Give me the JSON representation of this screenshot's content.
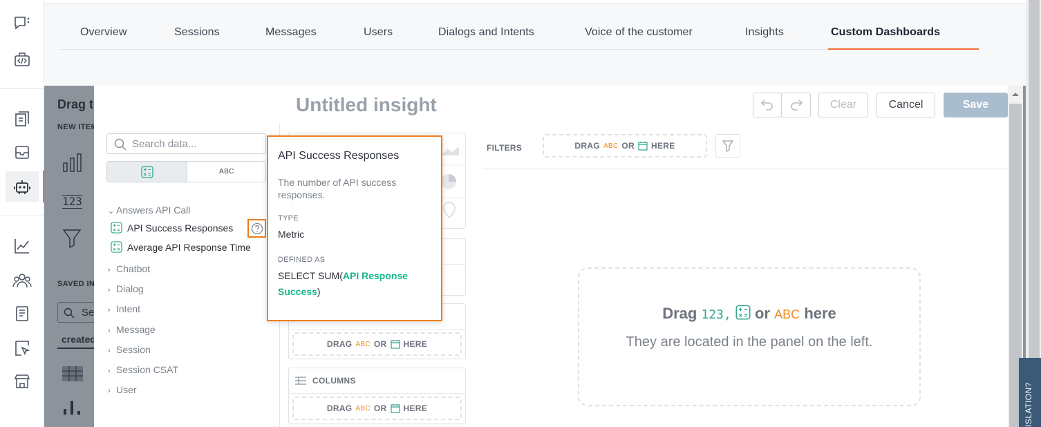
{
  "nav": {
    "tabs": [
      {
        "label": "Overview"
      },
      {
        "label": "Sessions"
      },
      {
        "label": "Messages"
      },
      {
        "label": "Users"
      },
      {
        "label": "Dialogs and Intents"
      },
      {
        "label": "Voice of the customer"
      },
      {
        "label": "Insights"
      },
      {
        "label": "Custom Dashboards",
        "active": true
      }
    ]
  },
  "background_panel": {
    "heading": "Drag to",
    "new_items_label": "NEW ITEM",
    "saved_label": "SAVED IN",
    "search_placeholder": "Se",
    "created_label": "created",
    "item_123": "123"
  },
  "modal": {
    "title": "Untitled insight",
    "buttons": {
      "clear": "Clear",
      "cancel": "Cancel",
      "save": "Save"
    },
    "search_placeholder": "Search data...",
    "toggle_abc": "ABC",
    "groups": [
      {
        "label": "Answers API Call",
        "expanded": true,
        "fields": [
          "API Success Responses",
          "Average API Response Time"
        ]
      },
      {
        "label": "Chatbot"
      },
      {
        "label": "Dialog"
      },
      {
        "label": "Intent"
      },
      {
        "label": "Message"
      },
      {
        "label": "Session"
      },
      {
        "label": "Session CSAT"
      },
      {
        "label": "User"
      }
    ],
    "wells": {
      "rows_drop": {
        "drag": "DRAG",
        "abc": "ABC",
        "or": "OR",
        "here": "HERE"
      },
      "columns": {
        "label": "COLUMNS",
        "drag": "DRAG",
        "abc": "ABC",
        "or": "OR",
        "here": "HERE"
      }
    },
    "filters": {
      "label": "FILTERS",
      "drag": "DRAG",
      "abc": "ABC",
      "or": "OR",
      "here": "HERE"
    },
    "canvas": {
      "drag": "Drag",
      "num": "123",
      "comma": ",",
      "or": "or",
      "abc": "ABC",
      "here": "here",
      "hint": "They are located in the panel on the left."
    }
  },
  "tooltip": {
    "title": "API Success Responses",
    "description": "The number of API success responses.",
    "type_label": "TYPE",
    "type_value": "Metric",
    "defined_label": "DEFINED AS",
    "defined_prefix": "SELECT SUM(",
    "defined_field": "API Response Success",
    "defined_suffix": ")"
  },
  "side_tab": {
    "label": "ISLATION?"
  },
  "colors": {
    "accent": "#f26b38",
    "highlight_border": "#f07d1c",
    "metric_green": "#17b58b",
    "abc_orange": "#f0891c",
    "save_disabled": "#a9bdcf"
  }
}
